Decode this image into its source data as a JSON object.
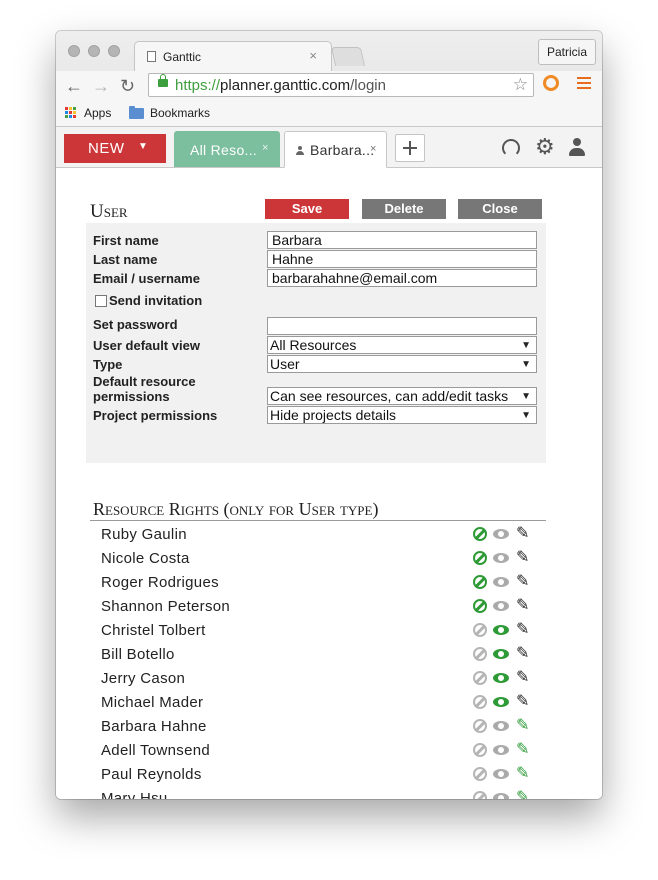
{
  "browser": {
    "tab_title": "Ganttic",
    "tab_close": "×",
    "profile": "Patricia",
    "url_scheme": "https://",
    "url_host": "planner.ganttic.com",
    "url_path": "/login",
    "back_glyph": "←",
    "forward_glyph": "→",
    "reload_glyph": "↻",
    "star_glyph": "☆",
    "bookmarks": {
      "apps": "Apps",
      "folder": "Bookmarks"
    }
  },
  "app": {
    "new_label": "NEW",
    "new_caret": "▼",
    "tabs": [
      {
        "label": "All Reso...",
        "close": "×"
      },
      {
        "label": "Barbara...",
        "close": "×"
      }
    ],
    "gear_glyph": "⚙"
  },
  "user_form": {
    "title": "User",
    "buttons": {
      "save": "Save",
      "delete": "Delete",
      "close": "Close"
    },
    "labels": {
      "first_name": "First name",
      "last_name": "Last name",
      "email": "Email / username",
      "send_invitation": "Send invitation",
      "set_password": "Set password",
      "default_view": "User default view",
      "type": "Type",
      "resource_permissions": "Default resource permissions",
      "project_permissions": "Project permissions"
    },
    "values": {
      "first_name": "Barbara",
      "last_name": "Hahne",
      "email": "barbarahahne@email.com",
      "set_password": "",
      "default_view": "All Resources",
      "type": "User",
      "resource_permissions": "Can see resources, can add/edit tasks",
      "project_permissions": "Hide projects details"
    },
    "send_invitation_checked": false,
    "select_caret": "▼"
  },
  "resource_rights": {
    "title": "Resource Rights (only for User type)",
    "pencil_glyph": "✎",
    "rows": [
      {
        "name": "Ruby Gaulin",
        "right": "none"
      },
      {
        "name": "Nicole Costa",
        "right": "none"
      },
      {
        "name": "Roger Rodrigues",
        "right": "none"
      },
      {
        "name": "Shannon Peterson",
        "right": "none"
      },
      {
        "name": "Christel Tolbert",
        "right": "view"
      },
      {
        "name": "Bill Botello",
        "right": "view"
      },
      {
        "name": "Jerry Cason",
        "right": "view"
      },
      {
        "name": "Michael Mader",
        "right": "view"
      },
      {
        "name": "Barbara Hahne",
        "right": "edit"
      },
      {
        "name": "Adell Townsend",
        "right": "edit"
      },
      {
        "name": "Paul Reynolds",
        "right": "edit"
      },
      {
        "name": "Mary Hsu",
        "right": "edit"
      }
    ]
  },
  "colors": {
    "brand_red": "#cd3638",
    "tab_green": "#7cbf9e",
    "active_green": "#2d9a36",
    "inactive_gray": "#aaaaaa"
  }
}
